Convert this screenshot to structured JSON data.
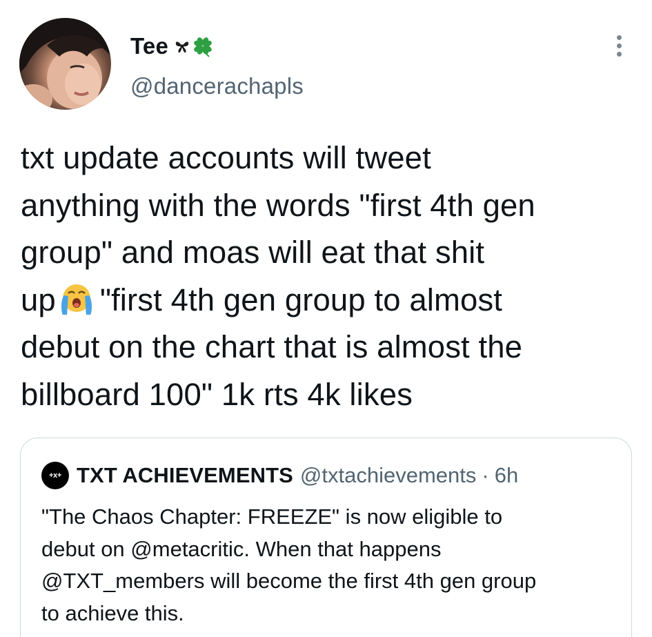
{
  "tweet": {
    "author": {
      "display_name": "Tee",
      "name_emojis": [
        "bow-emoji",
        "four-leaf-clover-emoji"
      ],
      "handle": "@dancerachapls"
    },
    "text_lines": [
      "txt update accounts will tweet",
      "anything with the words \"first 4th gen",
      "group\" and moas will eat that shit",
      "\"first 4th gen group to almost",
      "debut on the chart that is almost the",
      "billboard 100\" 1k rts 4k likes"
    ],
    "line4_prefix": "up",
    "inline_emoji": "loudly-crying-face-emoji",
    "more_icon": "more-vertical-icon"
  },
  "quoted_tweet": {
    "avatar_text": "+x+",
    "display_name": "TXT ACHIEVEMENTS",
    "handle": "@txtachievements",
    "separator": "·",
    "time": "6h",
    "text_lines": [
      "\"The Chaos Chapter: FREEZE\" is now eligible to",
      "debut on @metacritic. When that happens",
      "@TXT_members will become the first 4th gen group",
      "to achieve this."
    ]
  },
  "colors": {
    "text_primary": "#0f1419",
    "text_secondary": "#536471",
    "border": "#cfd9de",
    "clover_green": "#2ea043",
    "emoji_yellow": "#f7c443",
    "emoji_tear": "#4ba3e3"
  }
}
